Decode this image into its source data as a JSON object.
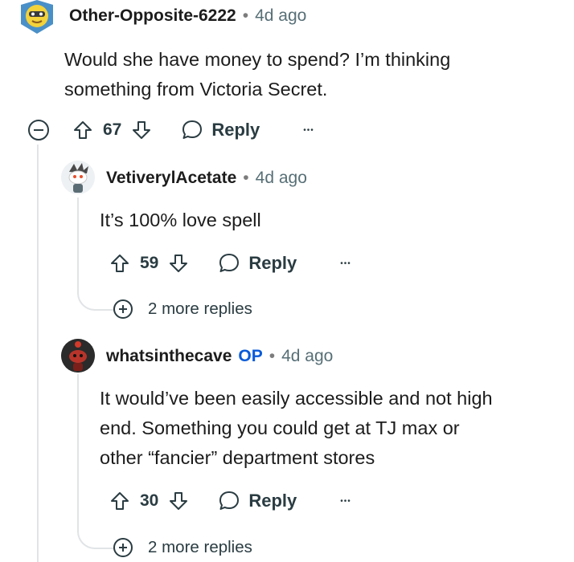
{
  "comments": [
    {
      "username": "Other-Opposite-6222",
      "separator": "•",
      "time": "4d ago",
      "body_lines": [
        "Would she have money to spend? I’m thinking",
        "something from Victoria Secret."
      ],
      "votes": "67",
      "reply_label": "Reply",
      "more_label": "•••"
    },
    {
      "username": "VetiverylAcetate",
      "separator": "•",
      "time": "4d ago",
      "body_lines": [
        "It’s 100% love spell"
      ],
      "votes": "59",
      "reply_label": "Reply",
      "more_label": "•••",
      "more_replies": "2 more replies"
    },
    {
      "username": "whatsinthecave",
      "op_badge": "OP",
      "separator": "•",
      "time": "4d ago",
      "body_lines": [
        "It would’ve been easily accessible and not high",
        "end. Something you could get at TJ max or",
        "other “fancier” department stores"
      ],
      "votes": "30",
      "reply_label": "Reply",
      "more_label": "•••",
      "more_replies": "2 more replies"
    }
  ],
  "colors": {
    "text": "#1c1c1c",
    "meta": "#576f76",
    "op": "#0a5bd8",
    "action": "#2a3c42",
    "thread": "#e1e4e6"
  }
}
